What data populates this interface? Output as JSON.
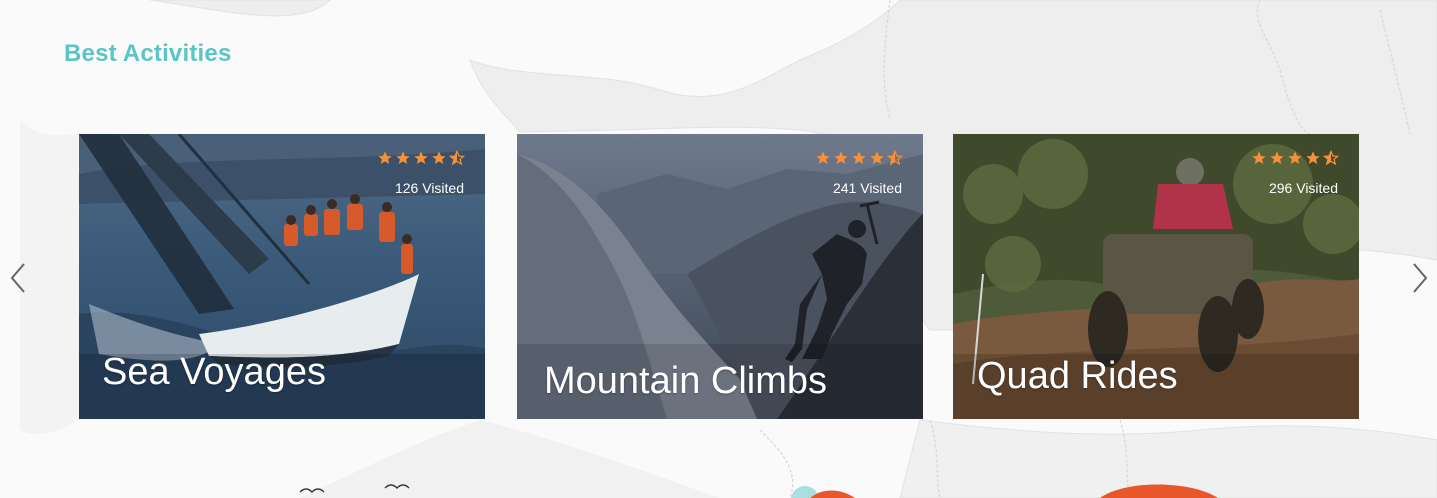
{
  "section": {
    "title": "Best Activities"
  },
  "nav": {
    "prev_icon": "chevron-left-icon",
    "next_icon": "chevron-right-icon"
  },
  "rating": {
    "stars": 4.5,
    "max": 5,
    "color": "#f5913a"
  },
  "cards": [
    {
      "title": "Sea Voyages",
      "visited": "126 Visited",
      "rating": 4.5
    },
    {
      "title": "Mountain Climbs",
      "visited": "241 Visited",
      "rating": 4.5
    },
    {
      "title": "Quad Rides",
      "visited": "296 Visited",
      "rating": 4.5
    }
  ],
  "colors": {
    "accent": "#5bc4c8",
    "orange": "#e8562a",
    "teal": "#a9dfe0"
  }
}
